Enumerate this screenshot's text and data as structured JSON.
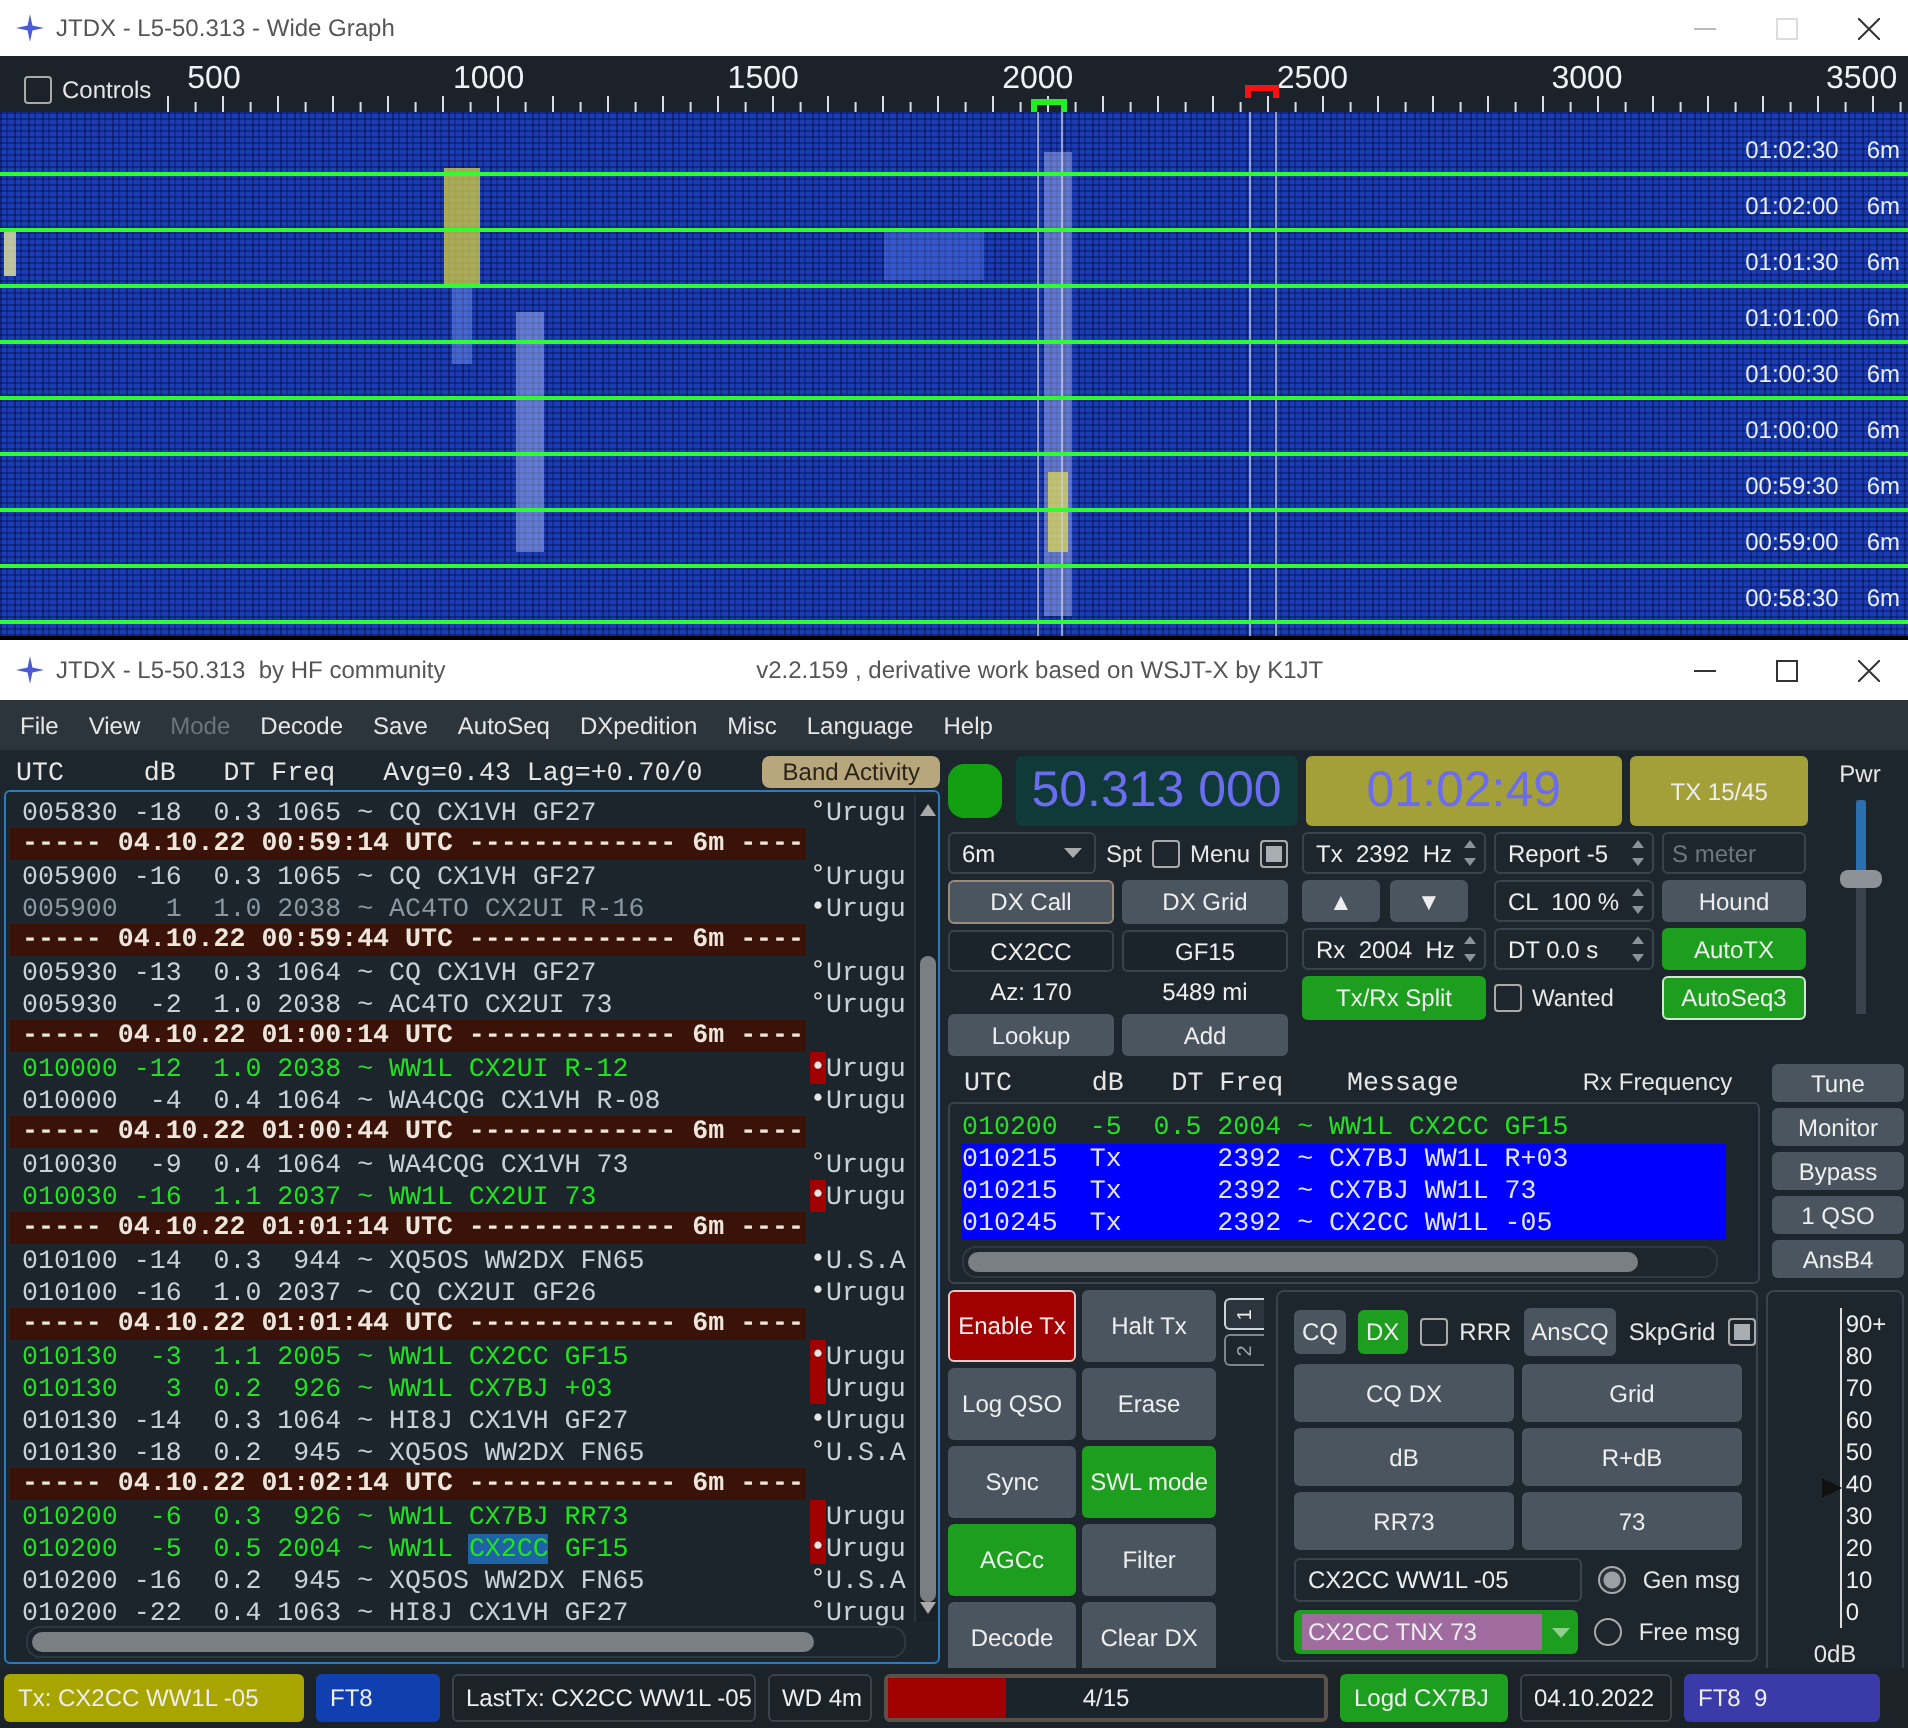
{
  "wide_graph": {
    "title": "JTDX - L5-50.313 - Wide Graph",
    "controls": {
      "label": "Controls",
      "checked": false
    },
    "freq_labels": [
      "500",
      "1000",
      "1500",
      "2000",
      "2500",
      "3000",
      "3500"
    ],
    "rows": [
      {
        "time": "01:02:30",
        "band": "6m"
      },
      {
        "time": "01:02:00",
        "band": "6m"
      },
      {
        "time": "01:01:30",
        "band": "6m"
      },
      {
        "time": "01:01:00",
        "band": "6m"
      },
      {
        "time": "01:00:30",
        "band": "6m"
      },
      {
        "time": "01:00:00",
        "band": "6m"
      },
      {
        "time": "00:59:30",
        "band": "6m"
      },
      {
        "time": "00:59:00",
        "band": "6m"
      },
      {
        "time": "00:58:30",
        "band": "6m"
      }
    ]
  },
  "main_window": {
    "title": "JTDX - L5-50.313  by HF community",
    "subtitle": "v2.2.159 , derivative work based on WSJT-X by K1JT"
  },
  "menu": [
    {
      "label": "File",
      "disabled": false
    },
    {
      "label": "View",
      "disabled": false
    },
    {
      "label": "Mode",
      "disabled": true
    },
    {
      "label": "Decode",
      "disabled": false
    },
    {
      "label": "Save",
      "disabled": false
    },
    {
      "label": "AutoSeq",
      "disabled": false
    },
    {
      "label": "DXpedition",
      "disabled": false
    },
    {
      "label": "Misc",
      "disabled": false
    },
    {
      "label": "Language",
      "disabled": false
    },
    {
      "label": "Help",
      "disabled": false
    }
  ],
  "band_activity": {
    "header": "UTC     dB   DT Freq",
    "stats": "Avg=0.43 Lag=+0.70/0",
    "button": "Band Activity",
    "rows": [
      {
        "kind": "decode",
        "line": "005830 -18  0.3 1065 ~ CQ CX1VH GF27",
        "highlighted": false,
        "dimmed": false,
        "marker": "°",
        "country": "Urugu",
        "flagged": false
      },
      {
        "kind": "separator",
        "line": "----- 04.10.22 00:59:14 UTC ------------- 6m ----"
      },
      {
        "kind": "decode",
        "line": "005900 -16  0.3 1065 ~ CQ CX1VH GF27",
        "highlighted": false,
        "dimmed": false,
        "marker": "°",
        "country": "Urugu",
        "flagged": false
      },
      {
        "kind": "decode",
        "line": "005900   1  1.0 2038 ~ AC4TO CX2UI R-16",
        "highlighted": false,
        "dimmed": true,
        "marker": "•",
        "country": "Urugu",
        "flagged": false
      },
      {
        "kind": "separator",
        "line": "----- 04.10.22 00:59:44 UTC ------------- 6m ----"
      },
      {
        "kind": "decode",
        "line": "005930 -13  0.3 1064 ~ CQ CX1VH GF27",
        "highlighted": false,
        "dimmed": false,
        "marker": "°",
        "country": "Urugu",
        "flagged": false
      },
      {
        "kind": "decode",
        "line": "005930  -2  1.0 2038 ~ AC4TO CX2UI 73",
        "highlighted": false,
        "dimmed": false,
        "marker": "°",
        "country": "Urugu",
        "flagged": false
      },
      {
        "kind": "separator",
        "line": "----- 04.10.22 01:00:14 UTC ------------- 6m ----"
      },
      {
        "kind": "decode",
        "line": "010000 -12  1.0 2038 ~ WW1L CX2UI R-12",
        "highlighted": true,
        "dimmed": false,
        "marker": "•",
        "country": "Urugu",
        "flagged": true
      },
      {
        "kind": "decode",
        "line": "010000  -4  0.4 1064 ~ WA4CQG CX1VH R-08",
        "highlighted": false,
        "dimmed": false,
        "marker": "•",
        "country": "Urugu",
        "flagged": false
      },
      {
        "kind": "separator",
        "line": "----- 04.10.22 01:00:44 UTC ------------- 6m ----"
      },
      {
        "kind": "decode",
        "line": "010030  -9  0.4 1064 ~ WA4CQG CX1VH 73",
        "highlighted": false,
        "dimmed": false,
        "marker": "°",
        "country": "Urugu",
        "flagged": false
      },
      {
        "kind": "decode",
        "line": "010030 -16  1.1 2037 ~ WW1L CX2UI 73",
        "highlighted": true,
        "dimmed": false,
        "marker": "•",
        "country": "Urugu",
        "flagged": true
      },
      {
        "kind": "separator",
        "line": "----- 04.10.22 01:01:14 UTC ------------- 6m ----"
      },
      {
        "kind": "decode",
        "line": "010100 -14  0.3  944 ~ XQ5OS WW2DX FN65",
        "highlighted": false,
        "dimmed": false,
        "marker": "•",
        "country": "U.S.A",
        "flagged": false
      },
      {
        "kind": "decode",
        "line": "010100 -16  1.0 2037 ~ CQ CX2UI GF26",
        "highlighted": false,
        "dimmed": false,
        "marker": "•",
        "country": "Urugu",
        "flagged": false
      },
      {
        "kind": "separator",
        "line": "----- 04.10.22 01:01:44 UTC ------------- 6m ----"
      },
      {
        "kind": "decode",
        "line": "010130  -3  1.1 2005 ~ WW1L CX2CC GF15",
        "highlighted": true,
        "dimmed": false,
        "marker": "•",
        "country": "Urugu",
        "flagged": true
      },
      {
        "kind": "decode",
        "line": "010130   3  0.2  926 ~ WW1L CX7BJ +03",
        "highlighted": true,
        "dimmed": false,
        "country": "Urugu",
        "flagged": true
      },
      {
        "kind": "decode",
        "line": "010130 -14  0.3 1064 ~ HI8J CX1VH GF27",
        "highlighted": false,
        "dimmed": false,
        "marker": "•",
        "country": "Urugu",
        "flagged": false
      },
      {
        "kind": "decode",
        "line": "010130 -18  0.2  945 ~ XQ5OS WW2DX FN65",
        "highlighted": false,
        "dimmed": false,
        "marker": "°",
        "country": "U.S.A",
        "flagged": false
      },
      {
        "kind": "separator",
        "line": "----- 04.10.22 01:02:14 UTC ------------- 6m ----"
      },
      {
        "kind": "decode",
        "line": "010200  -6  0.3  926 ~ WW1L CX7BJ RR73",
        "highlighted": true,
        "dimmed": false,
        "country": "Urugu",
        "flagged": true
      },
      {
        "kind": "decode",
        "line_parts": [
          {
            "text": "010200  -5  0.5 2004 ~ WW1L ",
            "selected": false
          },
          {
            "text": "CX2CC",
            "selected": true
          },
          {
            "text": " GF15",
            "selected": false
          }
        ],
        "highlighted": true,
        "dimmed": false,
        "marker": "•",
        "country": "Urugu",
        "flagged": true
      },
      {
        "kind": "decode",
        "line": "010200 -16  0.2  945 ~ XQ5OS WW2DX FN65",
        "highlighted": false,
        "dimmed": false,
        "marker": "°",
        "country": "U.S.A",
        "flagged": false
      },
      {
        "kind": "decode",
        "line": "010200 -22  0.4 1063 ~ HI8J CX1VH GF27",
        "highlighted": false,
        "dimmed": false,
        "marker": "°",
        "country": "Urugu",
        "flagged": false
      }
    ]
  },
  "rig": {
    "monitor_on": true,
    "frequency": "50.313 000",
    "clock": "01:02:49",
    "tx_period": "TX 15/45",
    "power": {
      "label": "Pwr",
      "level": 0.64
    },
    "band": "6m",
    "spot": {
      "label": "Spt",
      "checked": false
    },
    "menu_toggle": {
      "label": "Menu",
      "checked": true
    },
    "dx_call_button": "DX Call",
    "dx_grid_button": "DX Grid",
    "dx_call": "CX2CC",
    "dx_grid": "GF15",
    "azimuth": "Az: 170",
    "distance": "5489 mi",
    "lookup": "Lookup",
    "add": "Add",
    "tx_freq": "Tx  2392  Hz",
    "report": "Report -5",
    "s_meter_placeholder": "S meter",
    "up": "▲",
    "down": "▼",
    "cl": "CL  100 %",
    "rx_freq": "Rx  2004  Hz",
    "dt": "DT 0.0 s",
    "hound": {
      "label": "Hound",
      "on": false
    },
    "auto_tx": {
      "label": "AutoTX",
      "on": true
    },
    "split": {
      "label": "Tx/Rx Split",
      "on": true
    },
    "wanted": {
      "label": "Wanted",
      "checked": false
    },
    "autoseq": {
      "label": "AutoSeq3",
      "on": true
    }
  },
  "rx_frequency": {
    "header": "UTC     dB   DT Freq    Message",
    "title": "Rx Frequency",
    "rows": [
      {
        "kind": "rx",
        "line": "010200  -5  0.5 2004 ~ WW1L CX2CC GF15"
      },
      {
        "kind": "tx",
        "line": "010215  Tx      2392 ~ CX7BJ WW1L R+03"
      },
      {
        "kind": "tx",
        "line": "010215  Tx      2392 ~ CX7BJ WW1L 73"
      },
      {
        "kind": "tx",
        "line": "010245  Tx      2392 ~ CX2CC WW1L -05"
      }
    ]
  },
  "side_buttons": [
    "Tune",
    "Monitor",
    "Bypass",
    "1 QSO",
    "AnsB4"
  ],
  "controls": [
    {
      "label": "Enable Tx",
      "color": "#a00000"
    },
    {
      "label": "Halt Tx"
    },
    {
      "label": "Log QSO"
    },
    {
      "label": "Erase"
    },
    {
      "label": "Sync"
    },
    {
      "label": "SWL mode",
      "color": "#1e9e1e"
    },
    {
      "label": "AGCc",
      "color": "#1e9e1e"
    },
    {
      "label": "Filter"
    },
    {
      "label": "Decode"
    },
    {
      "label": "Clear DX"
    }
  ],
  "message_tabs": [
    {
      "label": "1",
      "selected": true
    },
    {
      "label": "2",
      "selected": false
    }
  ],
  "messages": {
    "cq": {
      "label": "CQ",
      "on": false
    },
    "dx": {
      "label": "DX",
      "on": true
    },
    "rrr": {
      "label": "RRR",
      "checked": false
    },
    "ans_cq": "AnsCQ",
    "skip_grid": {
      "label": "SkpGrid",
      "checked": true
    },
    "buttons": [
      "CQ DX",
      "Grid",
      "dB",
      "R+dB",
      "RR73",
      "73"
    ],
    "gen_text": "CX2CC WW1L -05",
    "free_text": "CX2CC TNX 73",
    "gen_msg": {
      "label": "Gen msg",
      "selected": true
    },
    "free_msg": {
      "label": "Free msg",
      "selected": false
    }
  },
  "signal_meter": {
    "scale": [
      "90+",
      "80",
      "70",
      "60",
      "50",
      "40",
      "30",
      "20",
      "10",
      "0"
    ],
    "unit": "0dB",
    "level": 0.44
  },
  "status_bar": [
    {
      "kind": "label",
      "text": "Tx: CX2CC WW1L -05",
      "color": "#a8a400"
    },
    {
      "kind": "label",
      "text": "FT8",
      "color": "#1040b0"
    },
    {
      "kind": "label",
      "text": "LastTx: CX2CC WW1L -05"
    },
    {
      "kind": "label",
      "text": "WD 4m"
    },
    {
      "kind": "progress",
      "text": "4/15",
      "level": 0.27
    },
    {
      "kind": "label",
      "text": "Logd CX7BJ",
      "color": "#1e9e1e"
    },
    {
      "kind": "label",
      "text": "04.10.2022"
    },
    {
      "kind": "label",
      "text": "FT8  9",
      "color": "#3a3aa8"
    }
  ]
}
